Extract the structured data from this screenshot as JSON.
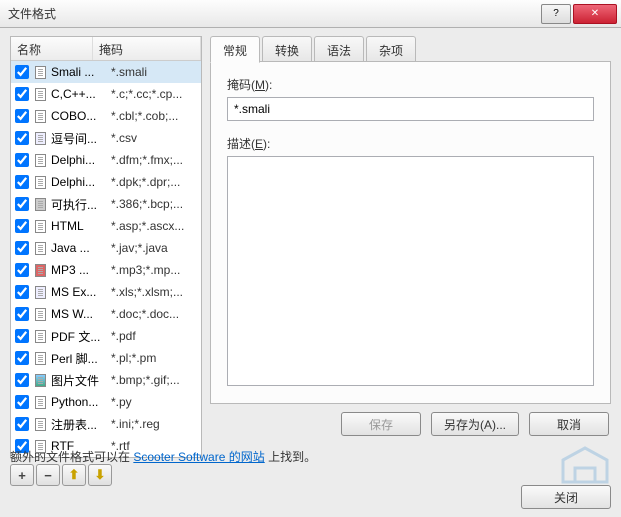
{
  "window": {
    "title": "文件格式"
  },
  "list": {
    "col_name": "名称",
    "col_mask": "掩码",
    "items": [
      {
        "name": "Smali ...",
        "mask": "*.smali",
        "selected": true,
        "icon": "doc"
      },
      {
        "name": "C,C++...",
        "mask": "*.c;*.cc;*.cp...",
        "icon": "doc"
      },
      {
        "name": "COBO...",
        "mask": "*.cbl;*.cob;...",
        "icon": "doc"
      },
      {
        "name": "逗号间...",
        "mask": "*.csv",
        "icon": "grid"
      },
      {
        "name": "Delphi...",
        "mask": "*.dfm;*.fmx;...",
        "icon": "doc"
      },
      {
        "name": "Delphi...",
        "mask": "*.dpk;*.dpr;...",
        "icon": "doc"
      },
      {
        "name": "可执行...",
        "mask": "*.386;*.bcp;...",
        "icon": "hex"
      },
      {
        "name": "HTML",
        "mask": "*.asp;*.ascx...",
        "icon": "doc"
      },
      {
        "name": "Java ...",
        "mask": "*.jav;*.java",
        "icon": "doc"
      },
      {
        "name": "MP3 ...",
        "mask": "*.mp3;*.mp...",
        "icon": "mp3"
      },
      {
        "name": "MS Ex...",
        "mask": "*.xls;*.xlsm;...",
        "icon": "grid"
      },
      {
        "name": "MS W...",
        "mask": "*.doc;*.doc...",
        "icon": "doc"
      },
      {
        "name": "PDF 文...",
        "mask": "*.pdf",
        "icon": "doc"
      },
      {
        "name": "Perl 脚...",
        "mask": "*.pl;*.pm",
        "icon": "doc"
      },
      {
        "name": "图片文件",
        "mask": "*.bmp;*.gif;...",
        "icon": "img"
      },
      {
        "name": "Python...",
        "mask": "*.py",
        "icon": "doc"
      },
      {
        "name": "注册表...",
        "mask": "*.ini;*.reg",
        "icon": "doc"
      },
      {
        "name": "RTF",
        "mask": "*.rtf",
        "icon": "doc"
      }
    ]
  },
  "toolbar": {
    "add": "+",
    "remove": "−",
    "up": "↑",
    "down": "↓"
  },
  "tabs": {
    "general": "常规",
    "convert": "转换",
    "syntax": "语法",
    "misc": "杂项"
  },
  "form": {
    "mask_label": "掩码(",
    "mask_key": "M",
    "mask_label2": "):",
    "mask_value": "*.smali",
    "desc_label": "描述(",
    "desc_key": "E",
    "desc_label2": "):",
    "desc_value": ""
  },
  "buttons": {
    "save": "保存",
    "saveas": "另存为(A)...",
    "cancel": "取消",
    "close": "关闭"
  },
  "footer": {
    "pre": "额外的文件格式可以在 ",
    "link": "Scooter Software 的网站",
    "post": " 上找到。"
  }
}
